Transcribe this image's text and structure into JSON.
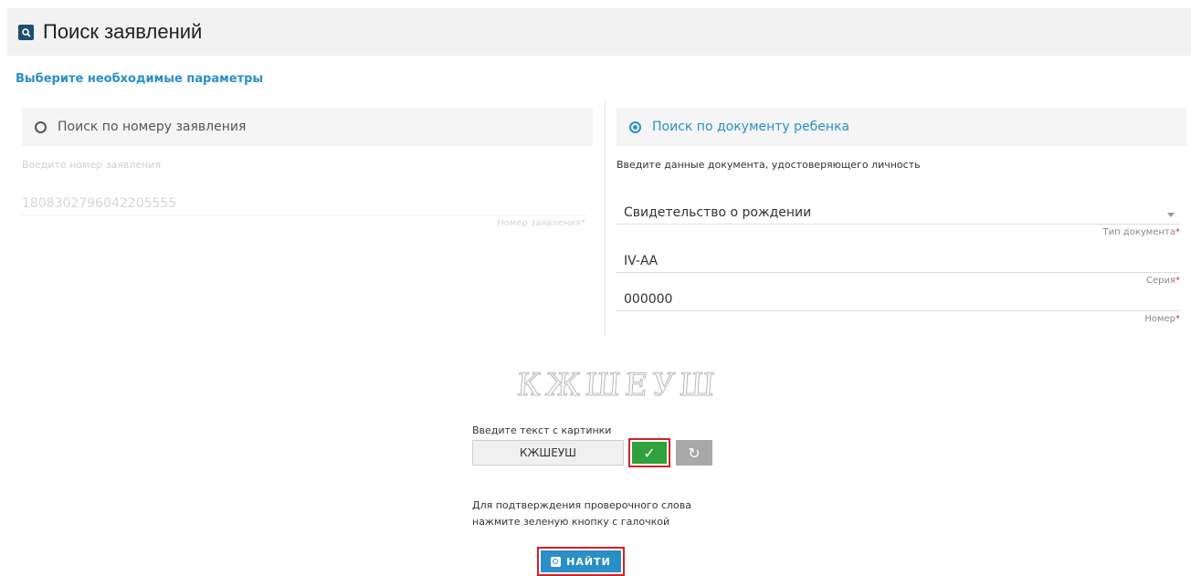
{
  "header": {
    "title": "Поиск заявлений",
    "icon": "search-document-icon"
  },
  "subtitle": "Выберите необходимые параметры",
  "left_panel": {
    "radio_label": "Поиск по номеру заявления",
    "hint": "Введите номер заявления",
    "number_value": "1808302796042205555",
    "number_label": "Номер заявления*"
  },
  "right_panel": {
    "radio_label": "Поиск по документу ребенка",
    "hint": "Введите данные документа, удостоверяющего личность",
    "doc_type_value": "Свидетельство о рождении",
    "doc_type_label": "Тип документа",
    "series_value": "IV-АА",
    "series_label": "Серия",
    "number_value": "000000",
    "number_label": "Номер",
    "required_mark": "*"
  },
  "captcha": {
    "image_text": "КЖШЕУШ",
    "hint": "Введите текст с картинки",
    "input_value": "КЖШЕУШ",
    "check_symbol": "✓",
    "refresh_symbol": "↻"
  },
  "confirm_note": {
    "line1": "Для подтверждения проверочного слова",
    "line2": "нажмите зеленую кнопку с галочкой"
  },
  "find_button": {
    "label": "НАЙТИ"
  },
  "colors": {
    "accent": "#2b8fc7",
    "confirm_green": "#2ea23c",
    "highlight_red": "#d61f26"
  }
}
